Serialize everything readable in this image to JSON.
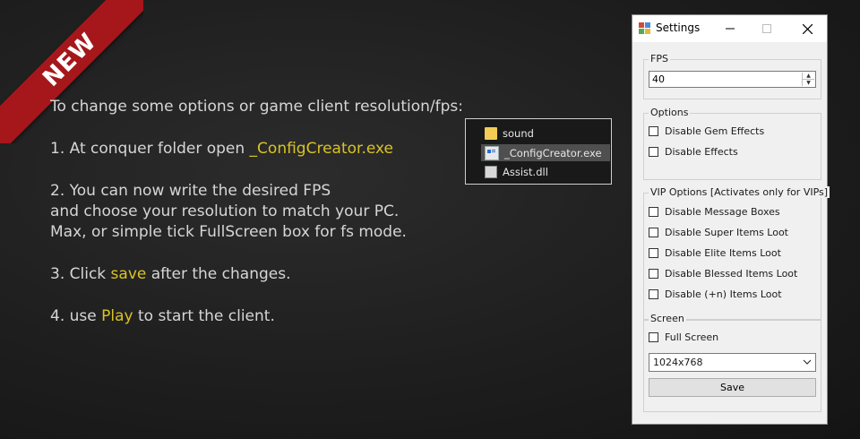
{
  "ribbon": {
    "label": "NEW",
    "color": "#a5171b"
  },
  "instructions": {
    "intro": "To change some options or game client resolution/fps:",
    "step1_prefix": "1. At conquer folder open ",
    "step1_highlight": "_ConfigCreator.exe",
    "step2_line1": "2. You can now write the desired FPS",
    "step2_line2": "and choose your resolution to match your PC.",
    "step2_line3": "Max, or simple tick FullScreen box for fs mode.",
    "step3_prefix": "3. Click ",
    "step3_highlight": "save",
    "step3_suffix": " after the changes.",
    "step4_prefix": "4. use ",
    "step4_highlight": "Play",
    "step4_suffix": " to start the client.",
    "highlight_color": "#d9c326"
  },
  "explorer": {
    "items": [
      {
        "name": "sound",
        "icon": "folder-icon"
      },
      {
        "name": "_ConfigCreator.exe",
        "icon": "exe-icon",
        "selected": true
      },
      {
        "name": "Assist.dll",
        "icon": "dll-icon"
      }
    ]
  },
  "settings_window": {
    "title": "Settings",
    "fps": {
      "label": "FPS",
      "value": "40"
    },
    "options": {
      "label": "Options",
      "items": [
        "Disable Gem Effects",
        "Disable Effects"
      ]
    },
    "vip": {
      "label": "VIP Options [Activates only for VIPs]",
      "items": [
        "Disable Message Boxes",
        "Disable Super Items Loot",
        "Disable Elite Items Loot",
        "Disable Blessed Items Loot",
        "Disable (+n) Items Loot"
      ]
    },
    "screen": {
      "label": "Screen",
      "fullscreen_label": "Full Screen",
      "resolution": "1024x768"
    },
    "save_label": "Save"
  }
}
